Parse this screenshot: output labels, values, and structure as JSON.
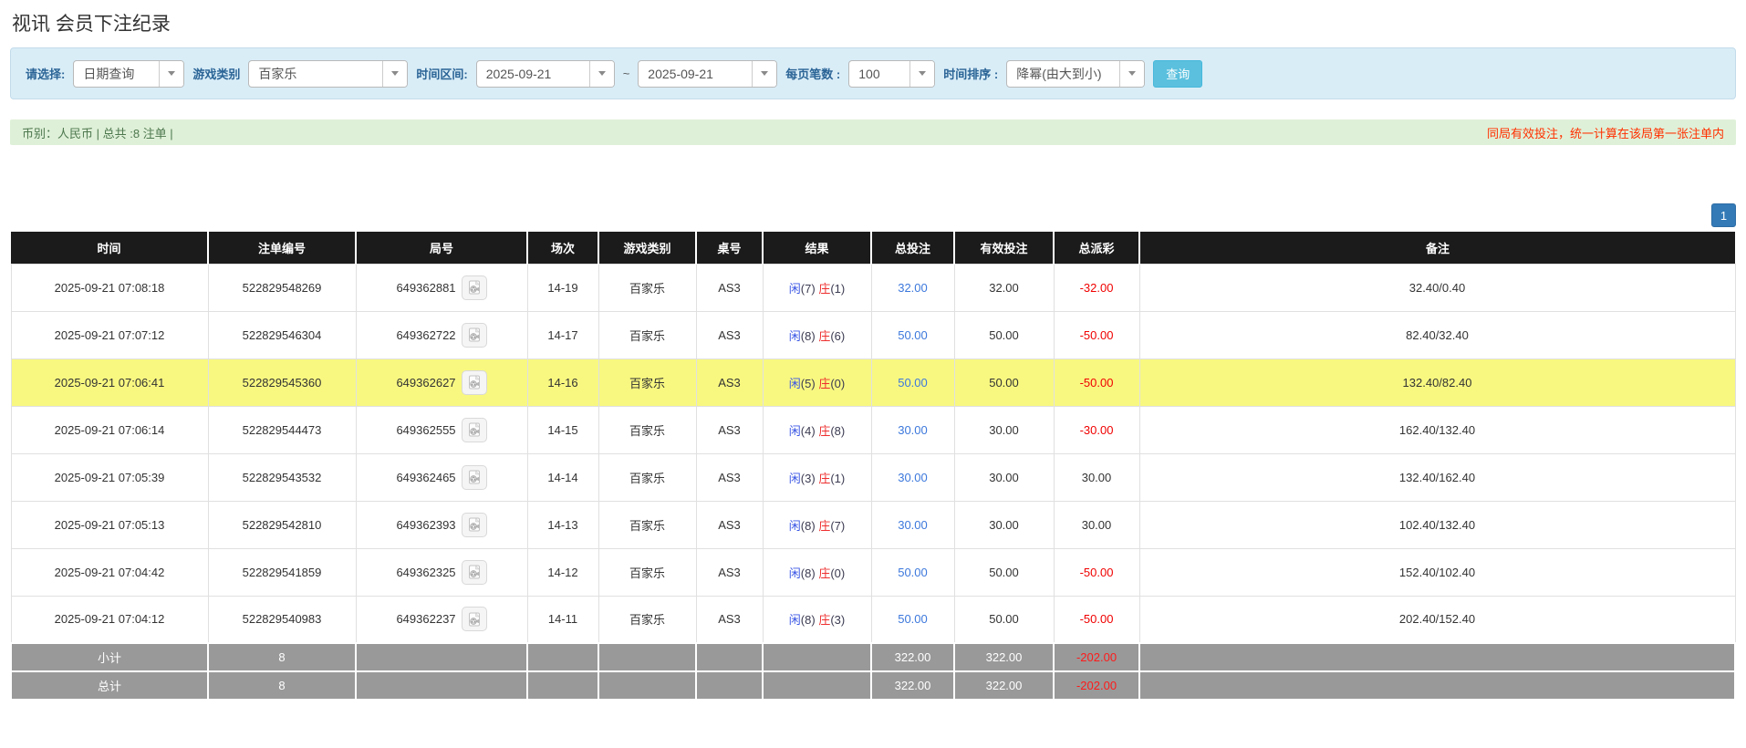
{
  "page_title": "视讯 会员下注纪录",
  "filter_bar": {
    "select_label": "请选择:",
    "query_type": "日期查询",
    "game_type_label": "游戏类别",
    "game_type": "百家乐",
    "time_range_label": "时间区间:",
    "date_from": "2025-09-21",
    "date_separator": "~",
    "date_to": "2025-09-21",
    "page_size_label": "每页笔数 :",
    "page_size": "100",
    "sort_label": "时间排序 :",
    "sort_order": "降幂(由大到小)",
    "search_button": "查询"
  },
  "summary_bar": {
    "left_text": "币别：人民币 | 总共 :8 注单 |",
    "right_note": "同局有效投注，统一计算在该局第一张注单内"
  },
  "pagination": {
    "current_page": "1"
  },
  "table": {
    "columns": [
      "时间",
      "注单编号",
      "局号",
      "场次",
      "游戏类别",
      "桌号",
      "结果",
      "总投注",
      "有效投注",
      "总派彩",
      "备注"
    ],
    "rows": [
      {
        "time": "2025-09-21 07:08:18",
        "bet_no": "522829548269",
        "round_no": "649362881",
        "session": "14-19",
        "game": "百家乐",
        "table_no": "AS3",
        "result": {
          "player_label": "闲",
          "player_value": "(7)",
          "banker_label": "庄",
          "banker_value": "(1)"
        },
        "total_bet": "32.00",
        "valid_bet": "32.00",
        "payout": "-32.00",
        "remark": "32.40/0.40",
        "highlighted": false
      },
      {
        "time": "2025-09-21 07:07:12",
        "bet_no": "522829546304",
        "round_no": "649362722",
        "session": "14-17",
        "game": "百家乐",
        "table_no": "AS3",
        "result": {
          "player_label": "闲",
          "player_value": "(8)",
          "banker_label": "庄",
          "banker_value": "(6)"
        },
        "total_bet": "50.00",
        "valid_bet": "50.00",
        "payout": "-50.00",
        "remark": "82.40/32.40",
        "highlighted": false
      },
      {
        "time": "2025-09-21 07:06:41",
        "bet_no": "522829545360",
        "round_no": "649362627",
        "session": "14-16",
        "game": "百家乐",
        "table_no": "AS3",
        "result": {
          "player_label": "闲",
          "player_value": "(5)",
          "banker_label": "庄",
          "banker_value": "(0)"
        },
        "total_bet": "50.00",
        "valid_bet": "50.00",
        "payout": "-50.00",
        "remark": "132.40/82.40",
        "highlighted": true
      },
      {
        "time": "2025-09-21 07:06:14",
        "bet_no": "522829544473",
        "round_no": "649362555",
        "session": "14-15",
        "game": "百家乐",
        "table_no": "AS3",
        "result": {
          "player_label": "闲",
          "player_value": "(4)",
          "banker_label": "庄",
          "banker_value": "(8)"
        },
        "total_bet": "30.00",
        "valid_bet": "30.00",
        "payout": "-30.00",
        "remark": "162.40/132.40",
        "highlighted": false
      },
      {
        "time": "2025-09-21 07:05:39",
        "bet_no": "522829543532",
        "round_no": "649362465",
        "session": "14-14",
        "game": "百家乐",
        "table_no": "AS3",
        "result": {
          "player_label": "闲",
          "player_value": "(3)",
          "banker_label": "庄",
          "banker_value": "(1)"
        },
        "total_bet": "30.00",
        "valid_bet": "30.00",
        "payout": "30.00",
        "remark": "132.40/162.40",
        "highlighted": false
      },
      {
        "time": "2025-09-21 07:05:13",
        "bet_no": "522829542810",
        "round_no": "649362393",
        "session": "14-13",
        "game": "百家乐",
        "table_no": "AS3",
        "result": {
          "player_label": "闲",
          "player_value": "(8)",
          "banker_label": "庄",
          "banker_value": "(7)"
        },
        "total_bet": "30.00",
        "valid_bet": "30.00",
        "payout": "30.00",
        "remark": "102.40/132.40",
        "highlighted": false
      },
      {
        "time": "2025-09-21 07:04:42",
        "bet_no": "522829541859",
        "round_no": "649362325",
        "session": "14-12",
        "game": "百家乐",
        "table_no": "AS3",
        "result": {
          "player_label": "闲",
          "player_value": "(8)",
          "banker_label": "庄",
          "banker_value": "(0)"
        },
        "total_bet": "50.00",
        "valid_bet": "50.00",
        "payout": "-50.00",
        "remark": "152.40/102.40",
        "highlighted": false
      },
      {
        "time": "2025-09-21 07:04:12",
        "bet_no": "522829540983",
        "round_no": "649362237",
        "session": "14-11",
        "game": "百家乐",
        "table_no": "AS3",
        "result": {
          "player_label": "闲",
          "player_value": "(8)",
          "banker_label": "庄",
          "banker_value": "(3)"
        },
        "total_bet": "50.00",
        "valid_bet": "50.00",
        "payout": "-50.00",
        "remark": "202.40/152.40",
        "highlighted": false
      }
    ],
    "footer_rows": [
      {
        "label": "小计",
        "count": "8",
        "total_bet": "322.00",
        "valid_bet": "322.00",
        "payout": "-202.00"
      },
      {
        "label": "总计",
        "count": "8",
        "total_bet": "322.00",
        "valid_bet": "322.00",
        "payout": "-202.00"
      }
    ]
  },
  "colors": {
    "header_bg": "#1b1b1b",
    "highlight_row": "#f8f881",
    "bet_link_blue": "#3c78dc",
    "negative_red": "#f00000",
    "player_blue": "#3a56e4",
    "banker_red": "#ee2f2f",
    "footer_bg": "#999999",
    "filter_bg": "#d9edf7",
    "summary_bg": "#dff0d8",
    "summary_text_green": "#4d784e",
    "note_red": "#ff3000",
    "search_button_bg": "#5bc0de",
    "pagination_bg": "#337ab7"
  }
}
